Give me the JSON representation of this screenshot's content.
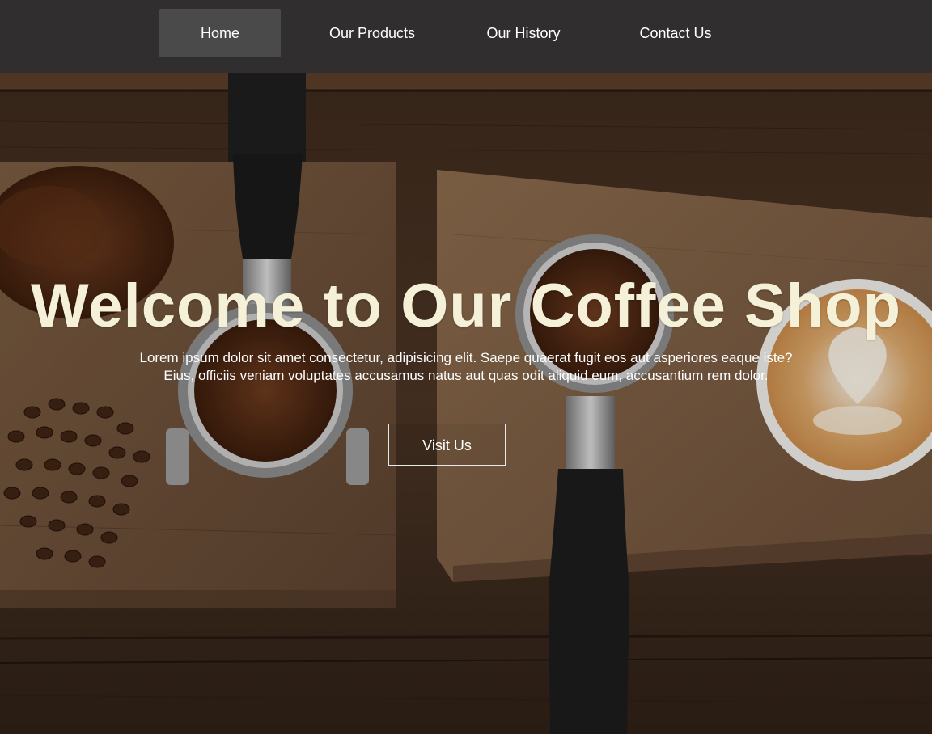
{
  "nav": {
    "items": [
      {
        "label": "Home",
        "active": true
      },
      {
        "label": "Our Products",
        "active": false
      },
      {
        "label": "Our History",
        "active": false
      },
      {
        "label": "Contact Us",
        "active": false
      }
    ]
  },
  "hero": {
    "title": "Welcome to Our Coffee Shop",
    "text_line1": "Lorem ipsum dolor sit amet consectetur, adipisicing elit. Saepe quaerat fugit eos aut asperiores eaque iste?",
    "text_line2": "Eius, officiis veniam voluptates accusamus natus aut quas odit aliquid eum, accusantium rem dolor.",
    "button_label": "Visit Us",
    "background_image": "coffee-tools-on-wooden-boards-photo"
  },
  "colors": {
    "nav_bg": "#302e2f",
    "nav_active_bg": "#4a4a4a",
    "title_color": "#f4f1d8",
    "text_color": "#ffffff"
  }
}
